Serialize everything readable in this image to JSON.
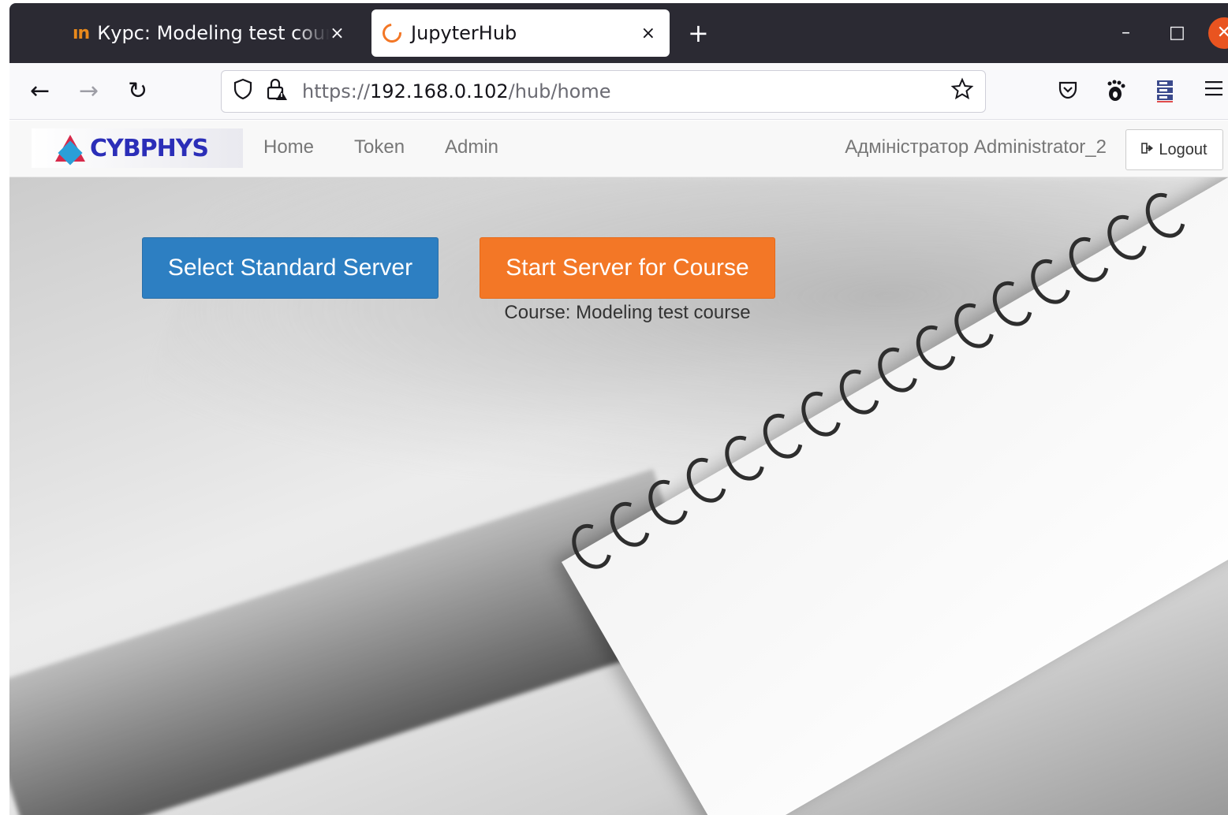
{
  "browser": {
    "tabs": [
      {
        "favicon": "ın",
        "title": "Курс: Modeling test course"
      },
      {
        "title": "JupyterHub",
        "active": true
      }
    ],
    "tab_close": "×",
    "new_tab": "+",
    "window_controls": {
      "minimize": "–",
      "maximize": "□",
      "close": "✕"
    },
    "nav": {
      "back": "←",
      "forward": "→",
      "reload": "↻"
    },
    "url": {
      "scheme": "https://",
      "host": "192.168.0.102",
      "path": "/hub/home"
    },
    "icons": [
      "shield-icon",
      "lock-icon",
      "star-icon",
      "pocket-icon",
      "gnome-extension-icon",
      "server-extension-icon",
      "hamburger-menu-icon"
    ]
  },
  "hub": {
    "logo_text": "CYBPHYS",
    "nav": [
      "Home",
      "Token",
      "Admin"
    ],
    "user": "Адміністратор Administrator_2",
    "logout": "Logout"
  },
  "main": {
    "select_button": "Select Standard Server",
    "start_button": "Start Server for Course",
    "course_label": "Course: Modeling test course"
  },
  "colors": {
    "select_button": "#2d7fc2",
    "start_button": "#f37726",
    "titlebar": "#2b2a33",
    "window_close": "#e95420"
  }
}
